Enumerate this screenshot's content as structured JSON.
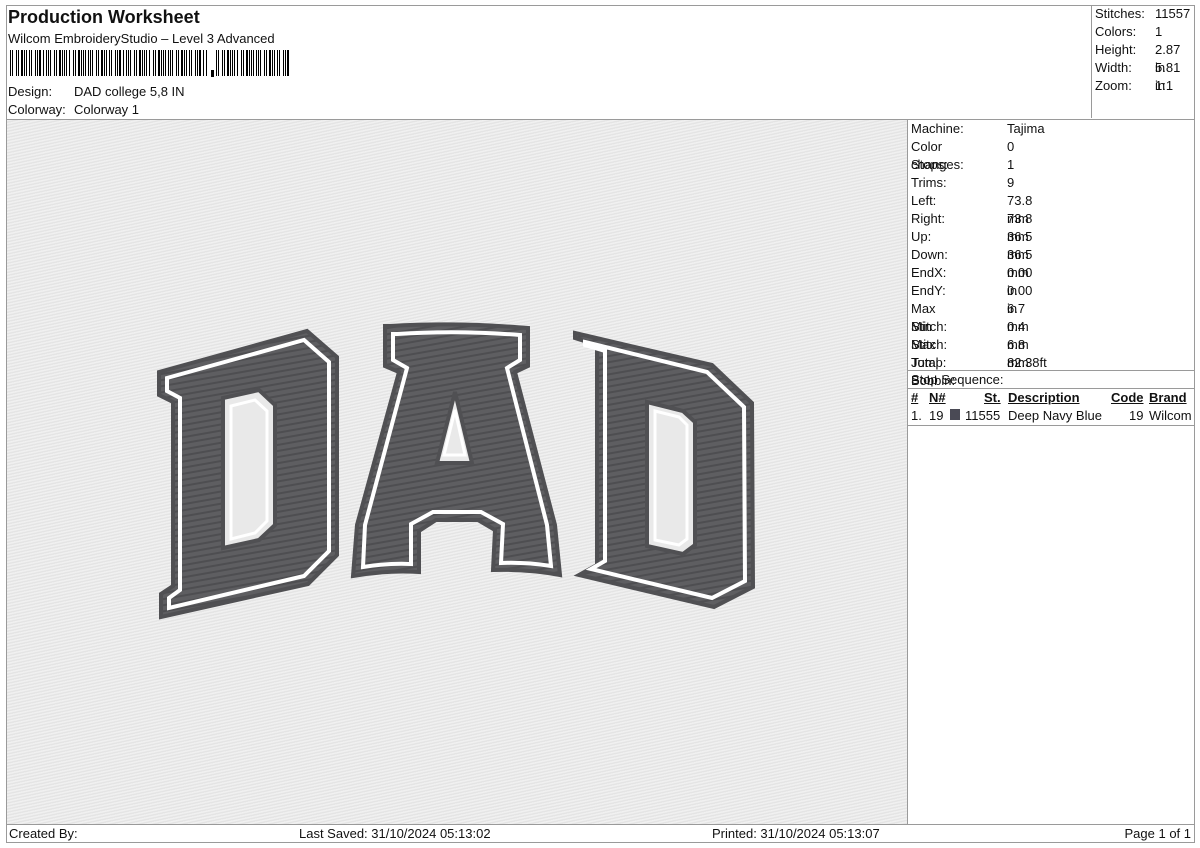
{
  "header": {
    "title": "Production Worksheet",
    "subtitle": "Wilcom EmbroideryStudio – Level 3 Advanced",
    "design_label": "Design:",
    "design_value": "DAD college 5,8 IN",
    "colorway_label": "Colorway:",
    "colorway_value": "Colorway 1"
  },
  "stats": [
    {
      "label": "Stitches:",
      "value": "11557"
    },
    {
      "label": "Colors:",
      "value": "1"
    },
    {
      "label": "Height:",
      "value": "2.87 in"
    },
    {
      "label": "Width:",
      "value": "5.81 in"
    },
    {
      "label": "Zoom:",
      "value": "1:1"
    }
  ],
  "design_preview": {
    "text": "DAD",
    "fill_color": "#5a5a5c",
    "outline_color": "#4a4a4c",
    "gap_color": "#ffffff",
    "fabric_color": "#e9e9e9"
  },
  "machine_info": [
    {
      "label": "Machine:",
      "value": "Tajima"
    },
    {
      "label": "Color changes:",
      "value": "0"
    },
    {
      "label": "Stops:",
      "value": "1"
    },
    {
      "label": "Trims:",
      "value": "9"
    },
    {
      "label": "Left:",
      "value": "73.8 mm"
    },
    {
      "label": "Right:",
      "value": "73.8 mm"
    },
    {
      "label": "Up:",
      "value": "36.5 mm"
    },
    {
      "label": "Down:",
      "value": "36.5 mm"
    },
    {
      "label": "EndX:",
      "value": "0.00 in"
    },
    {
      "label": "EndY:",
      "value": "0.00 in"
    },
    {
      "label": "Max Stitch:",
      "value": "6.7 mm"
    },
    {
      "label": "Min Stitch:",
      "value": "0.4 mm"
    },
    {
      "label": "Max Jump:",
      "value": "6.8 mm"
    },
    {
      "label": "Total Bobbin:",
      "value": "82.38ft"
    }
  ],
  "stop_sequence": {
    "label": "Stop Sequence:",
    "headers": {
      "num": "#",
      "needle": "N#",
      "stitches": "St.",
      "description": "Description",
      "code": "Code",
      "brand": "Brand"
    },
    "rows": [
      {
        "num": "1.",
        "needle": "19",
        "swatch": "#4a4a55",
        "stitches": "11555",
        "description": "Deep Navy Blue",
        "code": "19",
        "brand": "Wilcom"
      }
    ]
  },
  "footer": {
    "created_by": "Created By:",
    "last_saved": "Last Saved: 31/10/2024 05:13:02",
    "printed": "Printed: 31/10/2024 05:13:07",
    "page": "Page 1 of 1"
  }
}
